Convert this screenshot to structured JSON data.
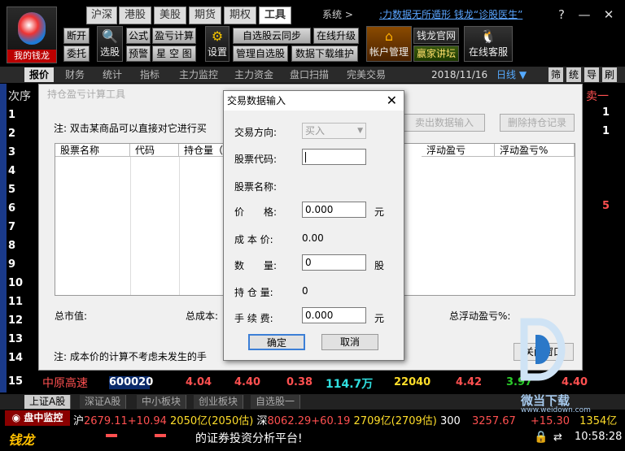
{
  "app": {
    "logo_label": "我的钱龙"
  },
  "top_tabs": [
    {
      "label": "沪深"
    },
    {
      "label": "港股"
    },
    {
      "label": "美股"
    },
    {
      "label": "期货"
    },
    {
      "label": "期权"
    },
    {
      "label": "工具"
    }
  ],
  "system_menu": "系统 >",
  "marquee_link": ":力数据无所遁形 钱龙“诊股医生”",
  "window_controls": [
    "?",
    "—",
    "✕"
  ],
  "toolbar": {
    "open_account": "断开",
    "entrust": "委托",
    "stock_select": "选股",
    "formula": "公式",
    "profit_calc": "盈亏计算",
    "warning": "预警",
    "long_short": "星 空 图",
    "settings": "设置",
    "cloud_sync": "自选股云同步",
    "online_upgrade": "在线升级",
    "manage_favorites": "管理自选股",
    "data_download": "数据下载维护",
    "account_mgmt": "帐户管理",
    "official_site": "钱龙官网",
    "forum": "赢家讲坛",
    "online_service": "在线客服"
  },
  "sub_tabs": [
    "报价",
    "财务",
    "统计",
    "指标",
    "主力监控",
    "主力资金",
    "盘口扫描",
    "完美交易"
  ],
  "date": "2018/11/16",
  "period": "日线 ▼",
  "right_tabs": [
    "筛",
    "统",
    "导",
    "刷"
  ],
  "left_header": "次序",
  "right_header": "卖一",
  "row_numbers": [
    "1",
    "2",
    "3",
    "4",
    "5",
    "6",
    "7",
    "8",
    "9",
    "10",
    "11",
    "12",
    "13",
    "14",
    "15"
  ],
  "right_edge_values": [
    "1",
    "1",
    "",
    "",
    "",
    "5",
    "",
    "",
    "",
    "",
    "",
    "",
    "",
    "",
    ""
  ],
  "main_dialog": {
    "title": "持仓盈亏计算工具",
    "note": "注: 双击某商品可以直接对它进行买",
    "btn_sell_input": "卖出数据输入",
    "btn_delete_record": "删除持仓记录",
    "columns": [
      "股票名称",
      "代码",
      "持仓量（",
      "浮动盈亏",
      "浮动盈亏%"
    ],
    "total_market_value": "总市值:",
    "total_cost": "总成本:",
    "total_float": "总浮动盈亏%:",
    "footnote": "注: 成本价的计算不考虑未发生的手",
    "close_window": "关闭窗口"
  },
  "modal": {
    "title": "交易数据输入",
    "direction_label": "交易方向:",
    "direction_value": "买入",
    "code_label": "股票代码:",
    "code_value": "",
    "name_label": "股票名称:",
    "price_label": "价　　格:",
    "price_value": "0.000",
    "price_unit": "元",
    "cost_label": "成 本 价:",
    "cost_value": "0.00",
    "qty_label": "数　　量:",
    "qty_value": "0",
    "qty_unit": "股",
    "hold_label": "持 仓 量:",
    "hold_value": "0",
    "fee_label": "手 续 费:",
    "fee_value": "0.000",
    "fee_unit": "元",
    "ok": "确定",
    "cancel": "取消"
  },
  "quote_row": {
    "num": "15",
    "name": "中原高速",
    "code": "600020",
    "v1": "4.04",
    "v2": "4.40",
    "v3": "0.38",
    "v4": "114.7万",
    "v5": "22040",
    "v6": "4.42",
    "v7": "3.97",
    "v8": "4.40"
  },
  "bottom_tabs": [
    "上证A股",
    "深证A股",
    "中小板块",
    "创业板块",
    "自选股一"
  ],
  "ticker": {
    "monitor": "盘中监控",
    "sh_label": "沪",
    "sh_text": "2679.11+10.94",
    "sh_vol": "2050亿",
    "sh_est": "(2050估)",
    "sz_label": "深",
    "sz_text": "8062.29+60.19",
    "sz_vol": "2709亿",
    "sz_est": "(2709估)",
    "hs300": "300",
    "hs300_val": "3257.67",
    "hs300_chg": "+15.30",
    "hs300_vol": "1354亿",
    "platform": "的证券投资分析平台!",
    "brand": "钱龙",
    "clock": "10:58:28"
  },
  "watermark": {
    "text": "微当下载",
    "site": "www.weidown.com"
  },
  "colors": {
    "red": "#ff3c3c",
    "yellow": "#ffde2a",
    "green": "#2acb2a",
    "cyan": "#30e0e0",
    "accent": "#3c7fd6"
  }
}
